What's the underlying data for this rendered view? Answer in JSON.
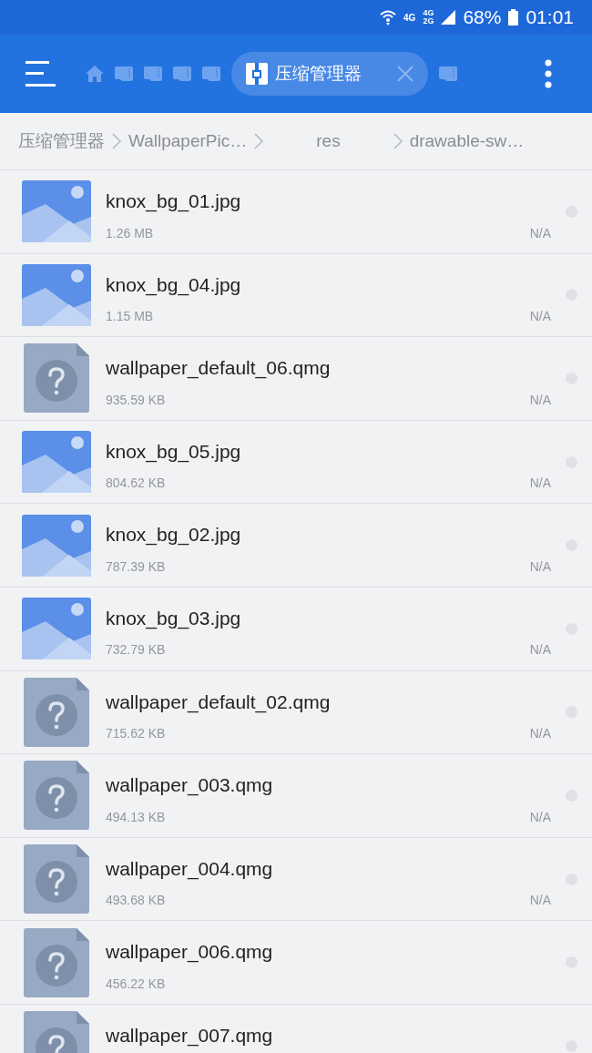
{
  "status_bar": {
    "network_1": "4G",
    "network_2": "4G",
    "network_3": "2G",
    "battery": "68%",
    "time": "01:01"
  },
  "toolbar": {
    "tabs": [
      {
        "kind": "home",
        "selected": false
      },
      {
        "kind": "card",
        "selected": false
      },
      {
        "kind": "card",
        "selected": false
      },
      {
        "kind": "card",
        "selected": false
      },
      {
        "kind": "card",
        "selected": false
      },
      {
        "kind": "archive",
        "label": "压缩管理器",
        "selected": true
      },
      {
        "kind": "card",
        "selected": false
      }
    ]
  },
  "breadcrumb": [
    "压缩管理器",
    "WallpaperPic…",
    "res",
    "drawable-sw…"
  ],
  "files": [
    {
      "kind": "image",
      "name": "knox_bg_01.jpg",
      "size": "1.26 MB",
      "date": "N/A",
      "checked": false
    },
    {
      "kind": "image",
      "name": "knox_bg_04.jpg",
      "size": "1.15 MB",
      "date": "N/A",
      "checked": false
    },
    {
      "kind": "unknown",
      "name": "wallpaper_default_06.qmg",
      "size": "935.59 KB",
      "date": "N/A",
      "checked": false
    },
    {
      "kind": "image",
      "name": "knox_bg_05.jpg",
      "size": "804.62 KB",
      "date": "N/A",
      "checked": false
    },
    {
      "kind": "image",
      "name": "knox_bg_02.jpg",
      "size": "787.39 KB",
      "date": "N/A",
      "checked": false
    },
    {
      "kind": "image",
      "name": "knox_bg_03.jpg",
      "size": "732.79 KB",
      "date": "N/A",
      "checked": false
    },
    {
      "kind": "unknown",
      "name": "wallpaper_default_02.qmg",
      "size": "715.62 KB",
      "date": "N/A",
      "checked": false
    },
    {
      "kind": "unknown",
      "name": "wallpaper_003.qmg",
      "size": "494.13 KB",
      "date": "N/A",
      "checked": false
    },
    {
      "kind": "unknown",
      "name": "wallpaper_004.qmg",
      "size": "493.68 KB",
      "date": "N/A",
      "checked": false
    },
    {
      "kind": "unknown",
      "name": "wallpaper_006.qmg",
      "size": "456.22 KB",
      "checked": false
    },
    {
      "kind": "unknown",
      "name": "wallpaper_007.qmg",
      "checked": false
    }
  ]
}
